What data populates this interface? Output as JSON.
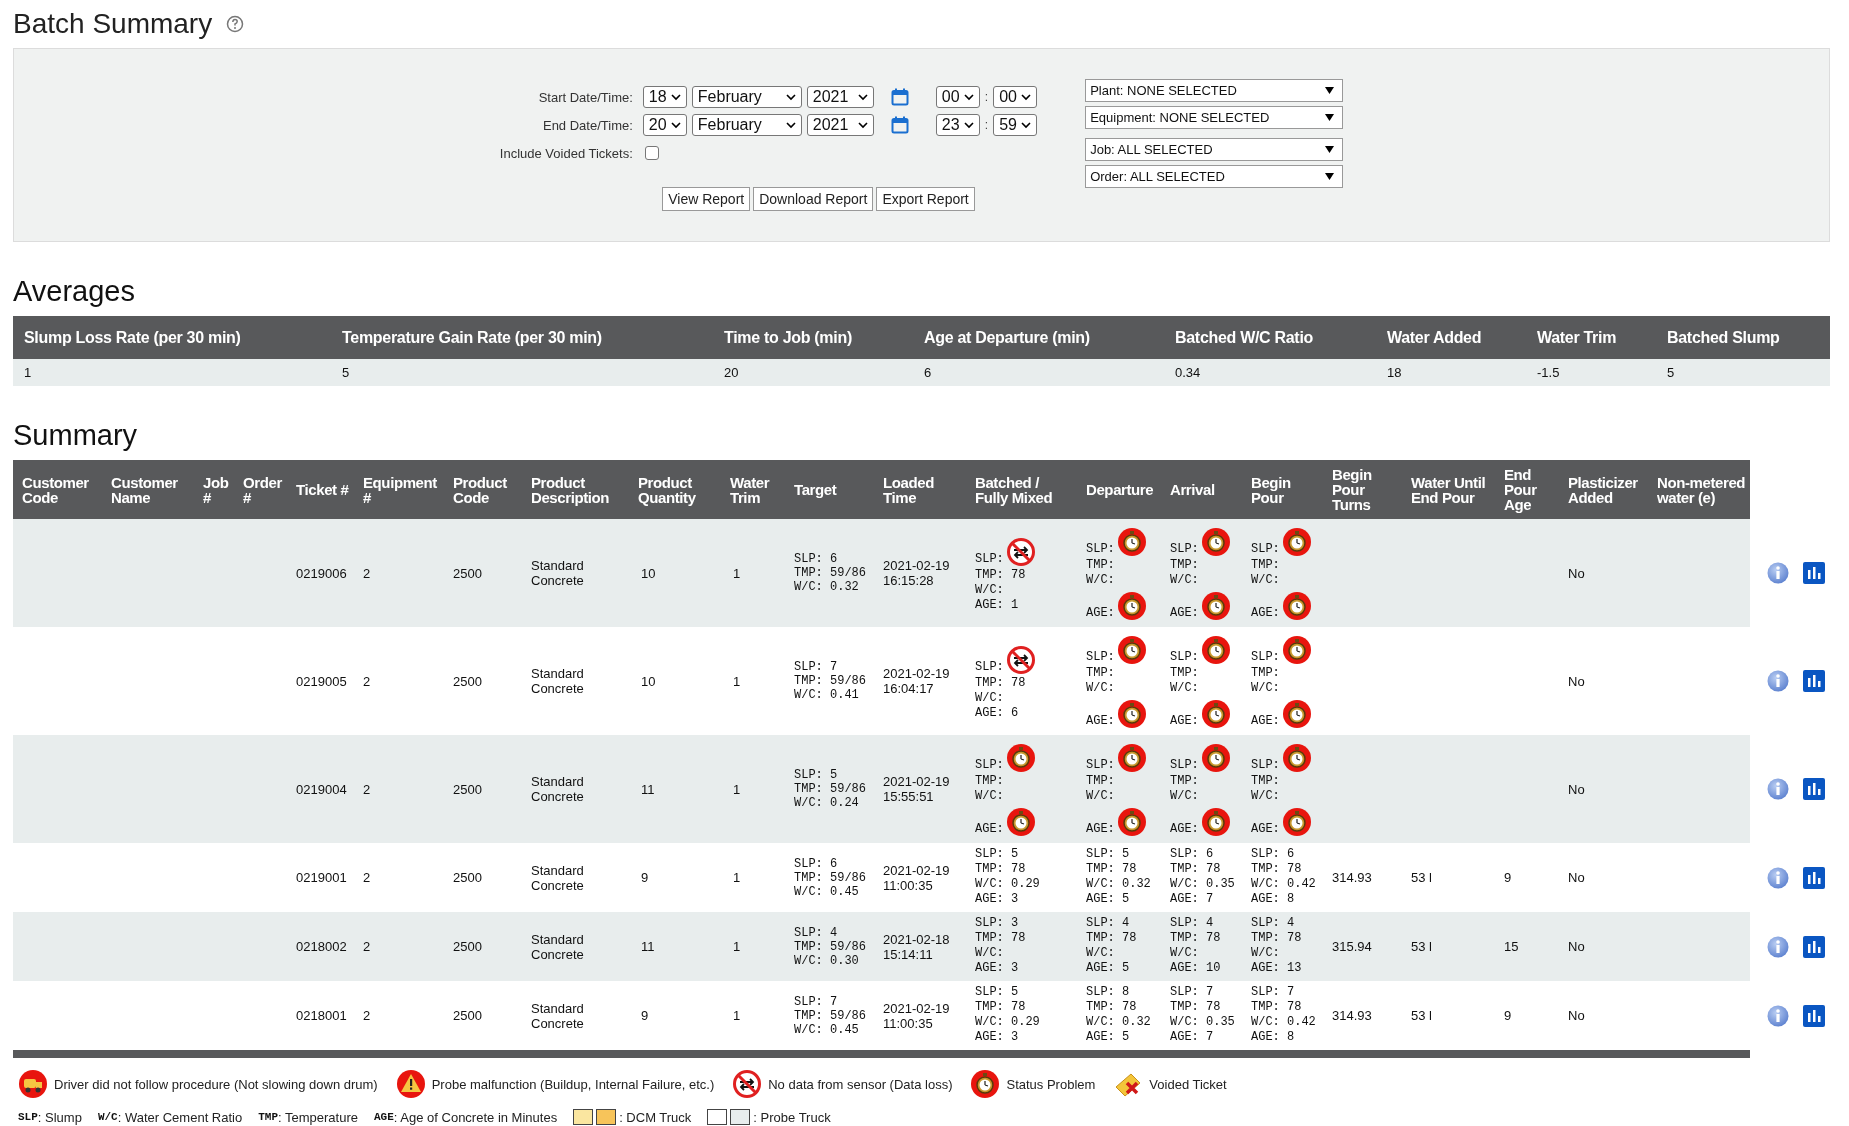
{
  "page": {
    "title": "Batch Summary"
  },
  "filters": {
    "date_rows": [
      {
        "label": "Start Date/Time:",
        "day": "18",
        "month": "February",
        "year": "2021",
        "hour": "00",
        "separator": ":",
        "minute": "00"
      },
      {
        "label": "End Date/Time:",
        "day": "20",
        "month": "February",
        "year": "2021",
        "hour": "23",
        "separator": ":",
        "minute": "59"
      }
    ],
    "include_voided": {
      "label": "Include Voided Tickets:",
      "checked": false
    },
    "buttons": [
      "View Report",
      "Download Report",
      "Export Report"
    ],
    "dropdowns": [
      "Plant: NONE SELECTED",
      "Equipment: NONE SELECTED",
      "Job: ALL SELECTED",
      "Order: ALL SELECTED"
    ]
  },
  "averages": {
    "title": "Averages",
    "columns": [
      "Slump Loss Rate (per 30 min)",
      "Temperature Gain Rate (per 30 min)",
      "Time to Job (min)",
      "Age at Departure (min)",
      "Batched W/C Ratio",
      "Water Added",
      "Water Trim",
      "Batched Slump"
    ],
    "values": [
      "1",
      "5",
      "20",
      "6",
      "0.34",
      "18",
      "-1.5",
      "5"
    ]
  },
  "summary": {
    "title": "Summary",
    "columns": [
      "Customer Code",
      "Customer Name",
      "Job #",
      "Order #",
      "Ticket #",
      "Equipment #",
      "Product Code",
      "Product Description",
      "Product Quantity",
      "Water Trim",
      "Target",
      "Loaded Time",
      "Batched / Fully Mixed",
      "Departure",
      "Arrival",
      "Begin Pour",
      "Begin Pour Turns",
      "Water Until End Pour",
      "End Pour Age",
      "Plasticizer Added",
      "Non-metered water (e)"
    ],
    "rows": [
      {
        "ticket": "0219006",
        "equipment": "2",
        "product_code": "2500",
        "description": "Standard Concrete",
        "quantity": "10",
        "water_trim": "1",
        "target": [
          "SLP: 6",
          "TMP: 59/86",
          "W/C: 0.32"
        ],
        "loaded_time": "2021-02-19 16:15:28",
        "stages": [
          {
            "lines": [
              "SLP:",
              "TMP: 78",
              "W/C:",
              "AGE: 1"
            ],
            "top_alert": {
              "kind": "no_data"
            }
          },
          {
            "lines": [
              "SLP:",
              "TMP:",
              "W/C:",
              "AGE:"
            ],
            "top_alert": {
              "kind": "status"
            },
            "bottom_alert": {
              "kind": "status"
            }
          },
          {
            "lines": [
              "SLP:",
              "TMP:",
              "W/C:",
              "AGE:"
            ],
            "top_alert": {
              "kind": "status"
            },
            "bottom_alert": {
              "kind": "status"
            }
          },
          {
            "lines": [
              "SLP:",
              "TMP:",
              "W/C:",
              "AGE:"
            ],
            "top_alert": {
              "kind": "status"
            },
            "bottom_alert": {
              "kind": "status"
            }
          }
        ],
        "plasticizer": "No"
      },
      {
        "ticket": "0219005",
        "equipment": "2",
        "product_code": "2500",
        "description": "Standard Concrete",
        "quantity": "10",
        "water_trim": "1",
        "target": [
          "SLP: 7",
          "TMP: 59/86",
          "W/C: 0.41"
        ],
        "loaded_time": "2021-02-19 16:04:17",
        "stages": [
          {
            "lines": [
              "SLP:",
              "TMP: 78",
              "W/C:",
              "AGE: 6"
            ],
            "top_alert": {
              "kind": "no_data"
            }
          },
          {
            "lines": [
              "SLP:",
              "TMP:",
              "W/C:",
              "AGE:"
            ],
            "top_alert": {
              "kind": "status"
            },
            "bottom_alert": {
              "kind": "status"
            }
          },
          {
            "lines": [
              "SLP:",
              "TMP:",
              "W/C:",
              "AGE:"
            ],
            "top_alert": {
              "kind": "status"
            },
            "bottom_alert": {
              "kind": "status"
            }
          },
          {
            "lines": [
              "SLP:",
              "TMP:",
              "W/C:",
              "AGE:"
            ],
            "top_alert": {
              "kind": "status"
            },
            "bottom_alert": {
              "kind": "status"
            }
          }
        ],
        "plasticizer": "No"
      },
      {
        "ticket": "0219004",
        "equipment": "2",
        "product_code": "2500",
        "description": "Standard Concrete",
        "quantity": "11",
        "water_trim": "1",
        "target": [
          "SLP: 5",
          "TMP: 59/86",
          "W/C: 0.24"
        ],
        "loaded_time": "2021-02-19 15:55:51",
        "stages": [
          {
            "lines": [
              "SLP:",
              "TMP:",
              "W/C:",
              "AGE:"
            ],
            "top_alert": {
              "kind": "status"
            },
            "bottom_alert": {
              "kind": "status"
            }
          },
          {
            "lines": [
              "SLP:",
              "TMP:",
              "W/C:",
              "AGE:"
            ],
            "top_alert": {
              "kind": "status"
            },
            "bottom_alert": {
              "kind": "status"
            }
          },
          {
            "lines": [
              "SLP:",
              "TMP:",
              "W/C:",
              "AGE:"
            ],
            "top_alert": {
              "kind": "status"
            },
            "bottom_alert": {
              "kind": "status"
            }
          },
          {
            "lines": [
              "SLP:",
              "TMP:",
              "W/C:",
              "AGE:"
            ],
            "top_alert": {
              "kind": "status"
            },
            "bottom_alert": {
              "kind": "status"
            }
          }
        ],
        "plasticizer": "No"
      },
      {
        "ticket": "0219001",
        "equipment": "2",
        "product_code": "2500",
        "description": "Standard Concrete",
        "quantity": "9",
        "water_trim": "1",
        "target": [
          "SLP: 6",
          "TMP: 59/86",
          "W/C: 0.45"
        ],
        "loaded_time": "2021-02-19 11:00:35",
        "stages": [
          {
            "lines": [
              "SLP: 5",
              "TMP: 78",
              "W/C: 0.29",
              "AGE: 3"
            ]
          },
          {
            "lines": [
              "SLP: 5",
              "TMP: 78",
              "W/C: 0.32",
              "AGE: 5"
            ]
          },
          {
            "lines": [
              "SLP: 6",
              "TMP: 78",
              "W/C: 0.35",
              "AGE: 7"
            ]
          },
          {
            "lines": [
              "SLP: 6",
              "TMP: 78",
              "W/C: 0.42",
              "AGE: 8"
            ]
          }
        ],
        "begin_pour_turns": "314.93",
        "water_until_end_pour": "53 l",
        "end_pour_age": "9",
        "plasticizer": "No"
      },
      {
        "ticket": "0218002",
        "equipment": "2",
        "product_code": "2500",
        "description": "Standard Concrete",
        "quantity": "11",
        "water_trim": "1",
        "target": [
          "SLP: 4",
          "TMP: 59/86",
          "W/C: 0.30"
        ],
        "loaded_time": "2021-02-18 15:14:11",
        "stages": [
          {
            "lines": [
              "SLP: 3",
              "TMP: 78",
              "W/C:",
              "AGE: 3"
            ]
          },
          {
            "lines": [
              "SLP: 4",
              "TMP: 78",
              "W/C:",
              "AGE: 5"
            ]
          },
          {
            "lines": [
              "SLP: 4",
              "TMP: 78",
              "W/C:",
              "AGE: 10"
            ]
          },
          {
            "lines": [
              "SLP: 4",
              "TMP: 78",
              "W/C:",
              "AGE: 13"
            ]
          }
        ],
        "begin_pour_turns": "315.94",
        "water_until_end_pour": "53 l",
        "end_pour_age": "15",
        "plasticizer": "No"
      },
      {
        "ticket": "0218001",
        "equipment": "2",
        "product_code": "2500",
        "description": "Standard Concrete",
        "quantity": "9",
        "water_trim": "1",
        "target": [
          "SLP: 7",
          "TMP: 59/86",
          "W/C: 0.45"
        ],
        "loaded_time": "2021-02-19 11:00:35",
        "stages": [
          {
            "lines": [
              "SLP: 5",
              "TMP: 78",
              "W/C: 0.29",
              "AGE: 3"
            ]
          },
          {
            "lines": [
              "SLP: 8",
              "TMP: 78",
              "W/C: 0.32",
              "AGE: 5"
            ]
          },
          {
            "lines": [
              "SLP: 7",
              "TMP: 78",
              "W/C: 0.35",
              "AGE: 7"
            ]
          },
          {
            "lines": [
              "SLP: 7",
              "TMP: 78",
              "W/C: 0.42",
              "AGE: 8"
            ]
          }
        ],
        "begin_pour_turns": "314.93",
        "water_until_end_pour": "53 l",
        "end_pour_age": "9",
        "plasticizer": "No"
      }
    ]
  },
  "legend": {
    "alerts": [
      {
        "kind": "driver",
        "text": "Driver did not follow procedure (Not slowing down drum)"
      },
      {
        "kind": "probe",
        "text": "Probe malfunction (Buildup, Internal Failure, etc.)"
      },
      {
        "kind": "no_data",
        "text": "No data from sensor (Data loss)"
      },
      {
        "kind": "status",
        "text": "Status Problem"
      },
      {
        "kind": "voided",
        "text": "Voided Ticket"
      }
    ],
    "abbreviations": [
      {
        "key": "SLP",
        "text": ": Slump"
      },
      {
        "key": "W/C",
        "text": ": Water Cement Ratio"
      },
      {
        "key": "TMP",
        "text": ": Temperature"
      },
      {
        "key": "AGE",
        "text": ": Age of Concrete in Minutes"
      }
    ],
    "trucks": [
      {
        "kind": "dcm",
        "text": ": DCM Truck"
      },
      {
        "kind": "probe",
        "text": ": Probe Truck"
      }
    ]
  }
}
